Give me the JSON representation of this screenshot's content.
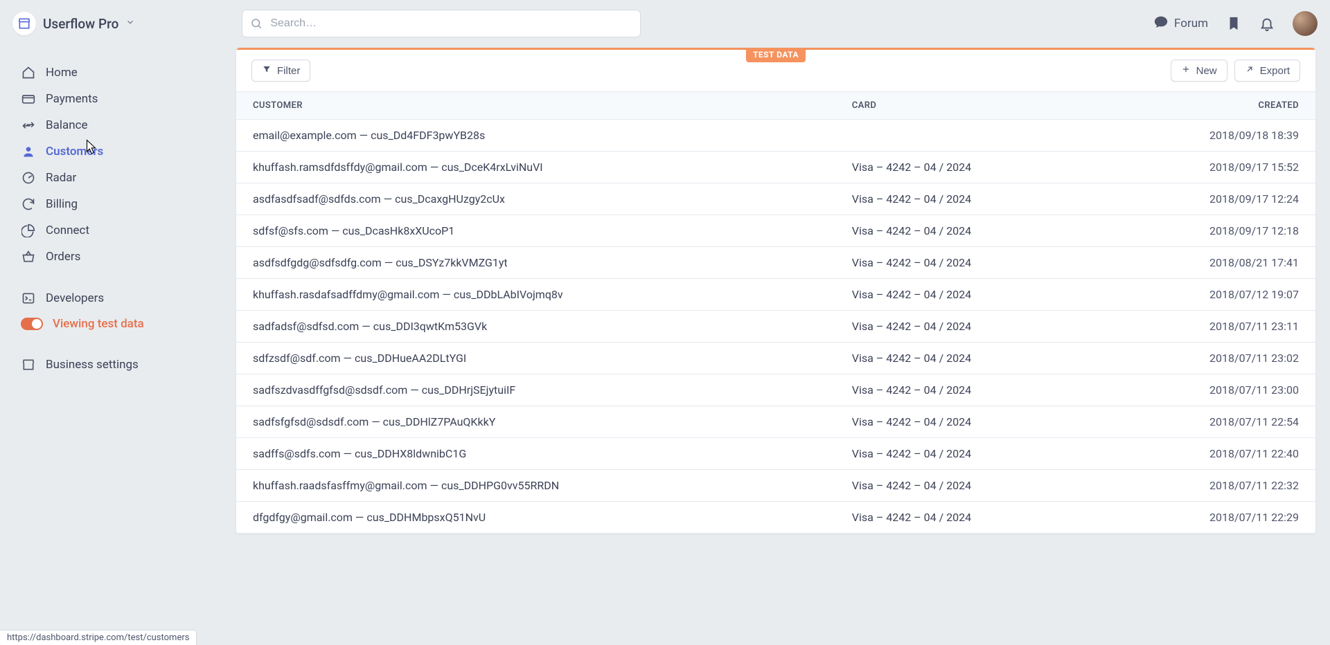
{
  "app": {
    "name": "Userflow Pro"
  },
  "search": {
    "placeholder": "Search…"
  },
  "top": {
    "forum": "Forum"
  },
  "sidebar": {
    "items": [
      {
        "label": "Home",
        "icon": "home"
      },
      {
        "label": "Payments",
        "icon": "credit-card"
      },
      {
        "label": "Balance",
        "icon": "arrows"
      },
      {
        "label": "Customers",
        "icon": "user",
        "active": true
      },
      {
        "label": "Radar",
        "icon": "radar"
      },
      {
        "label": "Billing",
        "icon": "cycle"
      },
      {
        "label": "Connect",
        "icon": "pie"
      },
      {
        "label": "Orders",
        "icon": "basket"
      }
    ],
    "developers": "Developers",
    "test_toggle": "Viewing test data",
    "business": "Business settings"
  },
  "badge": "TEST DATA",
  "toolbar": {
    "filter": "Filter",
    "new": "New",
    "export": "Export"
  },
  "columns": {
    "customer": "CUSTOMER",
    "card": "CARD",
    "created": "CREATED"
  },
  "rows": [
    {
      "customer": "email@example.com — cus_Dd4FDF3pwYB28s",
      "card": "",
      "created": "2018/09/18 18:39"
    },
    {
      "customer": "khuffash.ramsdfdsffdy@gmail.com — cus_DceK4rxLviNuVI",
      "card": "Visa – 4242 – 04 / 2024",
      "created": "2018/09/17 15:52"
    },
    {
      "customer": "asdfasdfsadf@sdfds.com — cus_DcaxgHUzgy2cUx",
      "card": "Visa – 4242 – 04 / 2024",
      "created": "2018/09/17 12:24"
    },
    {
      "customer": "sdfsf@sfs.com — cus_DcasHk8xXUcoP1",
      "card": "Visa – 4242 – 04 / 2024",
      "created": "2018/09/17 12:18"
    },
    {
      "customer": "asdfsdfgdg@sdfsdfg.com — cus_DSYz7kkVMZG1yt",
      "card": "Visa – 4242 – 04 / 2024",
      "created": "2018/08/21 17:41"
    },
    {
      "customer": "khuffash.rasdafsadffdmy@gmail.com — cus_DDbLAbIVojmq8v",
      "card": "Visa – 4242 – 04 / 2024",
      "created": "2018/07/12 19:07"
    },
    {
      "customer": "sadfadsf@sdfsd.com — cus_DDI3qwtKm53GVk",
      "card": "Visa – 4242 – 04 / 2024",
      "created": "2018/07/11 23:11"
    },
    {
      "customer": "sdfzsdf@sdf.com — cus_DDHueAA2DLtYGI",
      "card": "Visa – 4242 – 04 / 2024",
      "created": "2018/07/11 23:02"
    },
    {
      "customer": "sadfszdvasdffgfsd@sdsdf.com — cus_DDHrjSEjytuiIF",
      "card": "Visa – 4242 – 04 / 2024",
      "created": "2018/07/11 23:00"
    },
    {
      "customer": "sadfsfgfsd@sdsdf.com — cus_DDHlZ7PAuQKkkY",
      "card": "Visa – 4242 – 04 / 2024",
      "created": "2018/07/11 22:54"
    },
    {
      "customer": "sadffs@sdfs.com — cus_DDHX8ldwnibC1G",
      "card": "Visa – 4242 – 04 / 2024",
      "created": "2018/07/11 22:40"
    },
    {
      "customer": "khuffash.raadsfasffmy@gmail.com — cus_DDHPG0vv55RRDN",
      "card": "Visa – 4242 – 04 / 2024",
      "created": "2018/07/11 22:32"
    },
    {
      "customer": "dfgdfgy@gmail.com — cus_DDHMbpsxQ51NvU",
      "card": "Visa – 4242 – 04 / 2024",
      "created": "2018/07/11 22:29"
    }
  ],
  "status_url": "https://dashboard.stripe.com/test/customers"
}
